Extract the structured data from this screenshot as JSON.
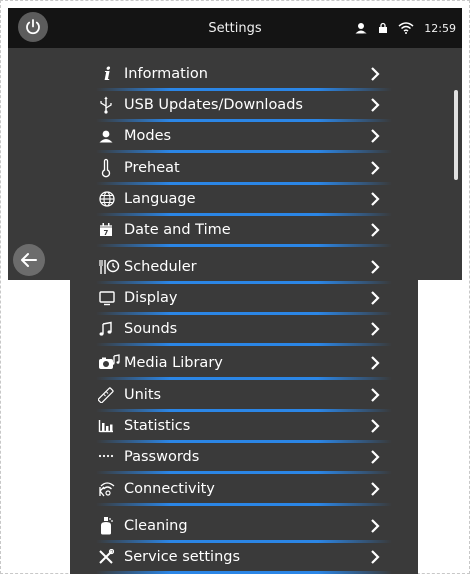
{
  "header": {
    "title": "Settings",
    "clock": "12:59"
  },
  "menu": {
    "items": [
      {
        "label": "Information",
        "icon": "info-icon"
      },
      {
        "label": "USB Updates/Downloads",
        "icon": "usb-icon"
      },
      {
        "label": "Modes",
        "icon": "user-icon"
      },
      {
        "label": "Preheat",
        "icon": "thermometer-icon"
      },
      {
        "label": "Language",
        "icon": "globe-icon"
      },
      {
        "label": "Date and Time",
        "icon": "calendar-icon"
      },
      {
        "label": "Scheduler",
        "icon": "scheduler-icon"
      },
      {
        "label": "Display",
        "icon": "monitor-icon"
      },
      {
        "label": "Sounds",
        "icon": "music-note-icon"
      },
      {
        "label": "Media Library",
        "icon": "media-library-icon"
      },
      {
        "label": "Units",
        "icon": "ruler-icon"
      },
      {
        "label": "Statistics",
        "icon": "bar-chart-icon"
      },
      {
        "label": "Passwords",
        "icon": "password-dots-icon"
      },
      {
        "label": "Connectivity",
        "icon": "wifi-connectivity-icon"
      },
      {
        "label": "Cleaning",
        "icon": "cleaning-icon"
      },
      {
        "label": "Service settings",
        "icon": "tools-icon"
      }
    ]
  },
  "colors": {
    "background": "#3a3a3a",
    "topbar": "#141414",
    "accent": "#2b86e6",
    "text": "#ffffff"
  }
}
